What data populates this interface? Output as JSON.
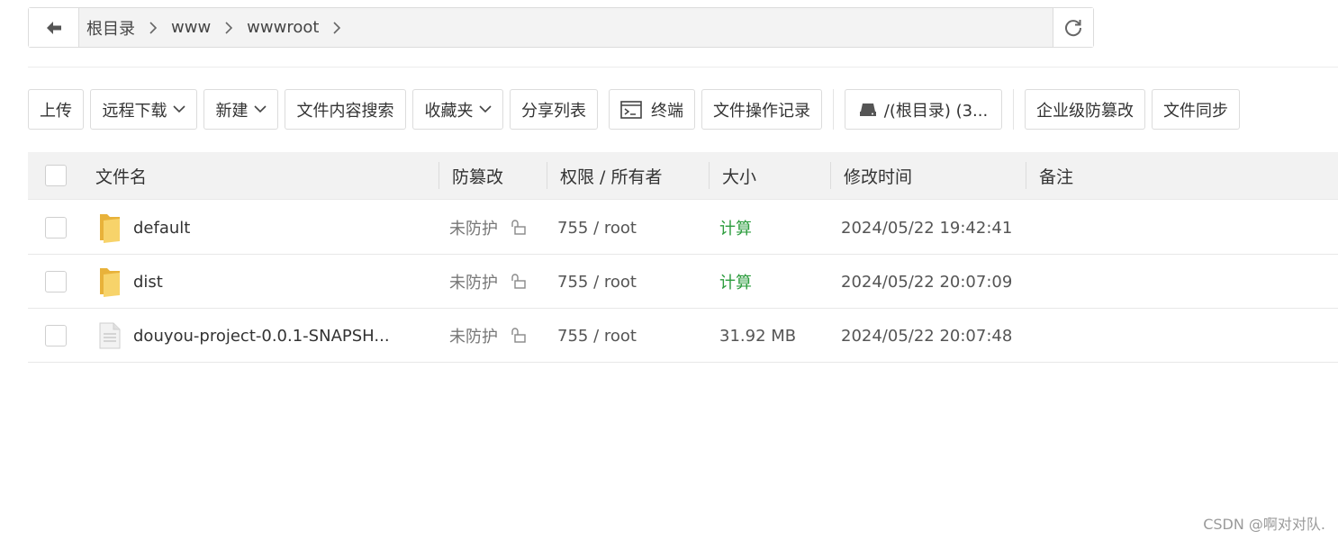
{
  "breadcrumbs": [
    "根目录",
    "www",
    "wwwroot"
  ],
  "toolbar": {
    "upload": "上传",
    "remote_download": "远程下载",
    "new": "新建",
    "content_search": "文件内容搜索",
    "favorites": "收藏夹",
    "share_list": "分享列表",
    "terminal": "终端",
    "operation_log": "文件操作记录",
    "disk": "/(根目录) (3...",
    "enterprise_tamper": "企业级防篡改",
    "file_sync": "文件同步"
  },
  "table": {
    "headers": {
      "name": "文件名",
      "tamper": "防篡改",
      "perm": "权限 / 所有者",
      "size": "大小",
      "mtime": "修改时间",
      "note": "备注"
    },
    "rows": [
      {
        "type": "folder",
        "name": "default",
        "tamper": "未防护",
        "perm": "755 / root",
        "size": "计算",
        "mtime": "2024/05/22 19:42:41"
      },
      {
        "type": "folder",
        "name": "dist",
        "tamper": "未防护",
        "perm": "755 / root",
        "size": "计算",
        "mtime": "2024/05/22 20:07:09"
      },
      {
        "type": "file",
        "name": "douyou-project-0.0.1-SNAPSH...",
        "tamper": "未防护",
        "perm": "755 / root",
        "size": "31.92 MB",
        "mtime": "2024/05/22 20:07:48"
      }
    ]
  },
  "watermark": "CSDN @啊对对队.",
  "colors": {
    "folder": "#f5c542",
    "calc_link": "#2e9d3f",
    "header_bg": "#f2f2f2"
  }
}
